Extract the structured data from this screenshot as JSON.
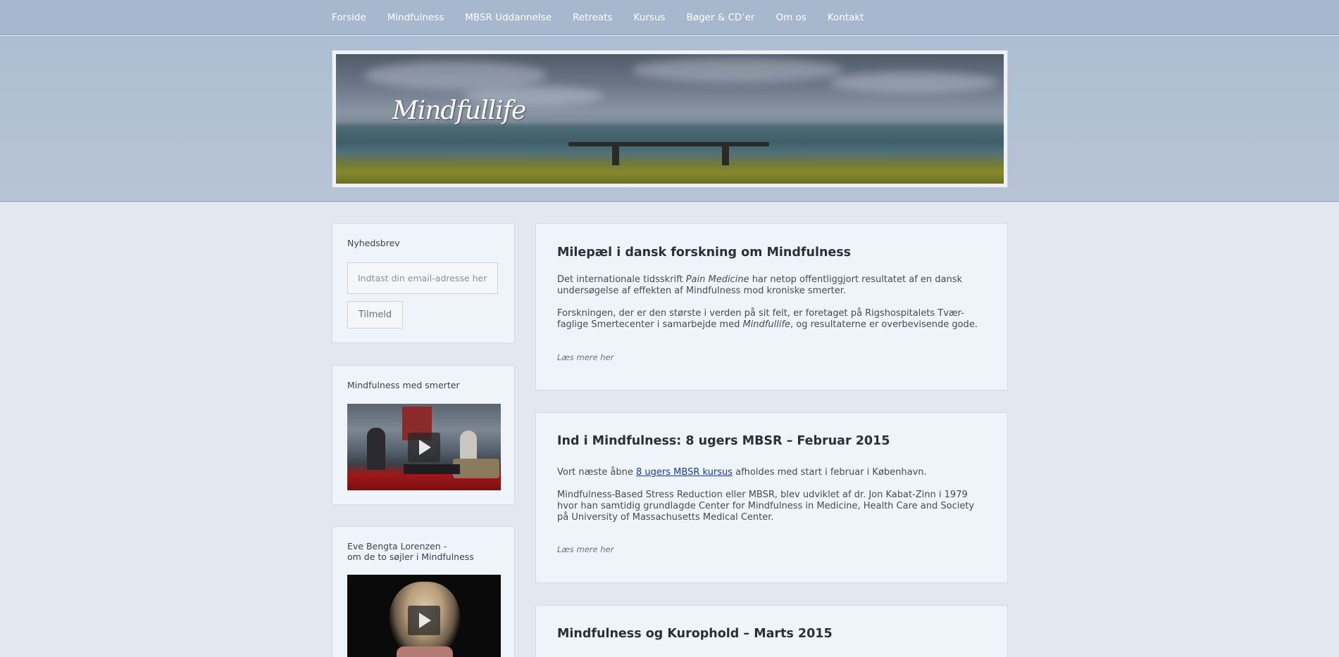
{
  "nav": {
    "items": [
      "Forside",
      "Mindfulness",
      "MBSR Uddannelse",
      "Retreats",
      "Kursus",
      "Bøger & CD’er",
      "Om os",
      "Kontakt"
    ]
  },
  "header": {
    "logo_text": "Mindfullife"
  },
  "newsletter": {
    "title": "Nyhedsbrev",
    "input_placeholder": "Indtast din email-adresse her",
    "button_label": "Tilmeld"
  },
  "video1": {
    "title": "Mindfulness med smerter",
    "icon": "play-icon"
  },
  "video2": {
    "title_line1": "Eve Bengta Lorenzen -",
    "title_line2": "om de to søjler i Mindfulness",
    "icon": "play-icon"
  },
  "posts": [
    {
      "title": "Milepæl i dansk forskning om Mindfulness",
      "p1_before": "Det internationale tidsskrift ",
      "p1_em": "Pain Medicine",
      "p1_after": " har netop offentliggjort resultatet af en dansk undersøgelse af effekten af Mindfulness mod kroniske smerter.",
      "p2_before": "Forskningen, der er den største i verden på sit felt, er foretaget på Rigshospitalets Tvær-faglige Smertecenter i samarbejde med ",
      "p2_em": "Mindfullife",
      "p2_after": ", og resultaterne er overbevisende gode.",
      "read_more": "Læs mere her"
    },
    {
      "title": "Ind i Mindfulness: 8 ugers MBSR – Februar 2015",
      "p1_before": "Vort næste åbne ",
      "p1_link": "8 ugers MBSR kursus",
      "p1_after": " afholdes med start i februar i København.",
      "p2": "Mindfulness-Based Stress Reduction eller MBSR,  blev udviklet af dr. Jon Kabat-Zinn i 1979 hvor han samtidig grundlagde Center for Mindfulness in Medicine, Health Care and Society på University of Massachusetts Medical Center.",
      "read_more": "Læs mere her"
    },
    {
      "title": "Mindfulness og Kurophold – Marts 2015"
    }
  ],
  "colors": {
    "nav_bg": "#a7b7cd",
    "page_bg": "#e3e8f0",
    "card_bg": "#eff3fa",
    "link": "#1f3a9a"
  }
}
